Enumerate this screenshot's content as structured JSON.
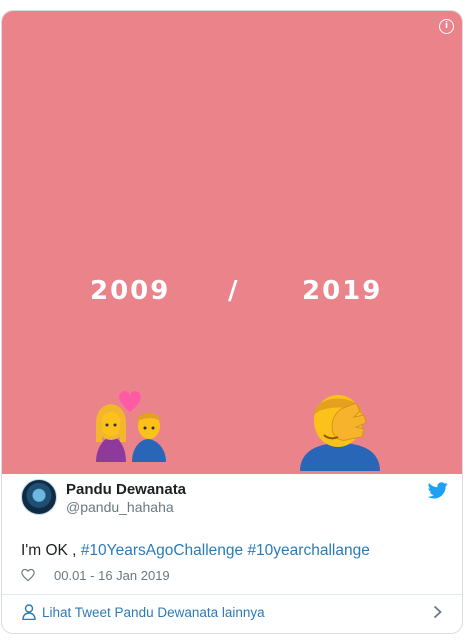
{
  "media": {
    "year_left": "2009",
    "separator": "/",
    "year_right": "2019",
    "emoji_left": "💑",
    "emoji_right": "🤦‍♂️",
    "background_color": "#eb838b"
  },
  "author": {
    "name": "Pandu Dewanata",
    "handle": "@pandu_hahaha"
  },
  "tweet": {
    "text_plain": "I'm OK , ",
    "hashtag_1": "#10YearsAgoChallenge",
    "hashtag_2": "#10yearchallange",
    "timestamp": "00.01 - 16 Jan 2019"
  },
  "footer": {
    "more_label": "Lihat Tweet Pandu Dewanata lainnya"
  },
  "colors": {
    "link": "#2b7bb9",
    "muted": "#697882",
    "twitter_blue": "#1da1f2"
  },
  "icons": [
    "info-icon",
    "twitter-bird-icon",
    "heart-icon",
    "person-icon",
    "chevron-right-icon"
  ]
}
